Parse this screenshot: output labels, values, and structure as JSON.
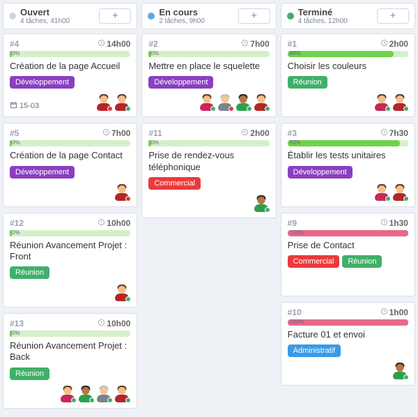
{
  "tag_colors": {
    "Développement": "#8a3fbf",
    "Réunion": "#3fb06a",
    "Commercial": "#ea3b3b",
    "Administratif": "#3a9ae6"
  },
  "people": {
    "alice": {
      "skin": "#f4c08a",
      "hair": "#6b3b2a",
      "body": "#c9265b"
    },
    "bob": {
      "skin": "#b87444",
      "hair": "#2b2b2b",
      "body": "#2e9f4d"
    },
    "carl": {
      "skin": "#f2c79a",
      "hair": "#bdbdbd",
      "body": "#7a828c"
    },
    "dana": {
      "skin": "#f4c08a",
      "hair": "#6b3b2a",
      "body": "#b3262a"
    }
  },
  "columns": [
    {
      "key": "open",
      "title": "Ouvert",
      "subtitle": "4 tâches, 41h00",
      "dot": "#cfd6df",
      "cards": [
        {
          "id": "#4",
          "duration": "14h00",
          "progress_label": "0%",
          "progress_width": 2,
          "progress_hot": false,
          "title": "Création de la page Accueil",
          "tags": [
            "Développement"
          ],
          "date": "15-03",
          "avatars": [
            {
              "person": "dana",
              "presence": "#e33939"
            },
            {
              "person": "dana",
              "presence": "#3fb06a"
            }
          ]
        },
        {
          "id": "#5",
          "duration": "7h00",
          "progress_label": "0%",
          "progress_width": 2,
          "progress_hot": false,
          "title": "Création de la page Contact",
          "tags": [
            "Développement"
          ],
          "avatars": [
            {
              "person": "dana",
              "presence": "#e33939"
            }
          ]
        },
        {
          "id": "#12",
          "duration": "10h00",
          "progress_label": "0%",
          "progress_width": 2,
          "progress_hot": false,
          "title": "Réunion Avancement Projet : Front",
          "tags": [
            "Réunion"
          ],
          "avatars": [
            {
              "person": "dana",
              "presence": "#3fb06a"
            }
          ]
        },
        {
          "id": "#13",
          "duration": "10h00",
          "progress_label": "0%",
          "progress_width": 2,
          "progress_hot": false,
          "title": "Réunion Avancement Projet : Back",
          "tags": [
            "Réunion"
          ],
          "avatars": [
            {
              "person": "alice",
              "presence": "#3fb06a"
            },
            {
              "person": "bob",
              "presence": "#3fb06a"
            },
            {
              "person": "carl",
              "presence": "#3fb06a"
            },
            {
              "person": "dana",
              "presence": "#3fb06a"
            }
          ]
        }
      ]
    },
    {
      "key": "inprogress",
      "title": "En cours",
      "subtitle": "2 tâches, 9h00",
      "dot": "#5aa8e6",
      "cards": [
        {
          "id": "#2",
          "duration": "7h00",
          "progress_label": "0%",
          "progress_width": 2,
          "progress_hot": false,
          "title": "Mettre en place le squelette",
          "tags": [
            "Développement"
          ],
          "avatars": [
            {
              "person": "alice",
              "presence": "#3fb06a"
            },
            {
              "person": "carl",
              "presence": "#e33939"
            },
            {
              "person": "bob",
              "presence": "#3fb06a"
            },
            {
              "person": "dana",
              "presence": "#3fb06a"
            }
          ]
        },
        {
          "id": "#11",
          "duration": "2h00",
          "progress_label": "0%",
          "progress_width": 2,
          "progress_hot": false,
          "title": "Prise de rendez-vous téléphonique",
          "tags": [
            "Commercial"
          ],
          "avatars": [
            {
              "person": "bob",
              "presence": "#3fb06a"
            }
          ]
        }
      ]
    },
    {
      "key": "done",
      "title": "Terminé",
      "subtitle": "4 tâches, 12h00",
      "dot": "#3fb06a",
      "cards": [
        {
          "id": "#1",
          "duration": "2h00",
          "progress_label": "88%",
          "progress_width": 88,
          "progress_hot": false,
          "title": "Choisir les couleurs",
          "tags": [
            "Réunion"
          ],
          "avatars": [
            {
              "person": "alice",
              "presence": "#3fb06a"
            },
            {
              "person": "dana",
              "presence": "#3fb06a"
            }
          ]
        },
        {
          "id": "#3",
          "duration": "7h30",
          "progress_label": "93%",
          "progress_width": 93,
          "progress_hot": false,
          "title": "Établir les tests unitaires",
          "tags": [
            "Développement"
          ],
          "avatars": [
            {
              "person": "alice",
              "presence": "#3fb06a"
            },
            {
              "person": "dana",
              "presence": "#3fb06a"
            }
          ]
        },
        {
          "id": "#9",
          "duration": "1h30",
          "progress_label": "133%",
          "progress_width": 100,
          "progress_hot": true,
          "title": "Prise de Contact",
          "tags": [
            "Commercial",
            "Réunion"
          ],
          "avatars": []
        },
        {
          "id": "#10",
          "duration": "1h00",
          "progress_label": "100%",
          "progress_width": 100,
          "progress_hot": true,
          "title": "Facture 01 et envoi",
          "tags": [
            "Administratif"
          ],
          "avatars": [
            {
              "person": "bob",
              "presence": "#3fb06a"
            }
          ]
        }
      ]
    }
  ]
}
